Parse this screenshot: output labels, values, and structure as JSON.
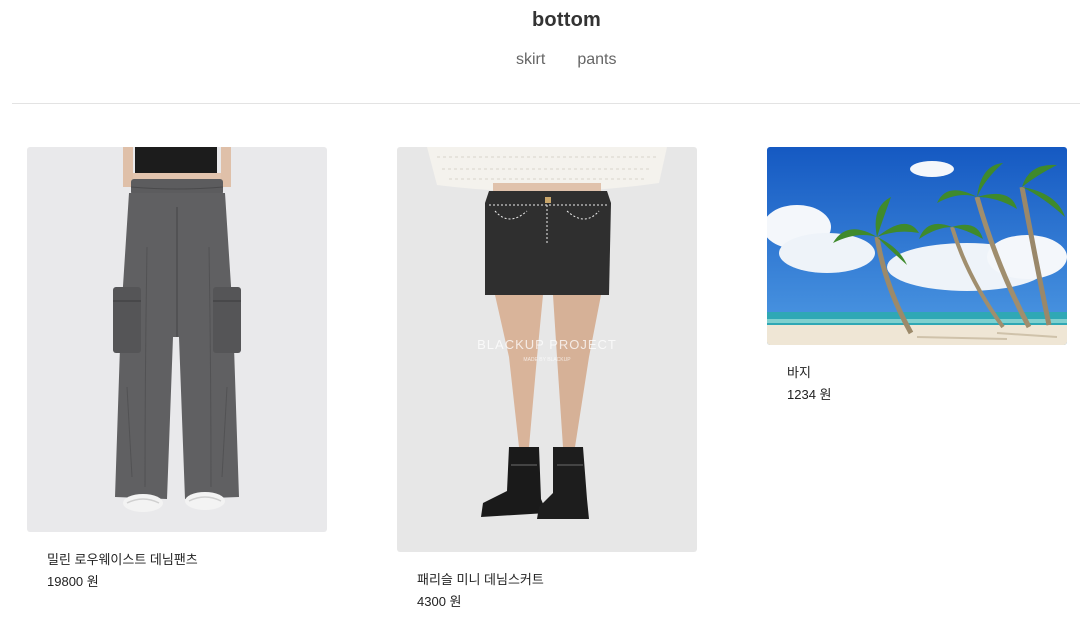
{
  "header": {
    "title": "bottom",
    "tabs": [
      {
        "label": "skirt"
      },
      {
        "label": "pants"
      }
    ]
  },
  "products": [
    {
      "name": "밀린 로우웨이스트 데님팬츠",
      "price": "19800 원",
      "image": "gray-cargo-pants-photo"
    },
    {
      "name": "패리슬 미니 데님스커트",
      "price": "4300 원",
      "image": "black-mini-skirt-photo",
      "watermark": "BLACKUP PROJECT",
      "watermark_sub": "MADE BY BLACKUP"
    },
    {
      "name": "바지",
      "price": "1234 원",
      "image": "beach-palm-trees-photo"
    }
  ],
  "colors": {
    "title": "#333333",
    "nav": "#666666",
    "divider": "#e3e3e3",
    "sky": "#1f6fd1",
    "sand": "#efe6d5",
    "sea": "#2fa8b5"
  }
}
